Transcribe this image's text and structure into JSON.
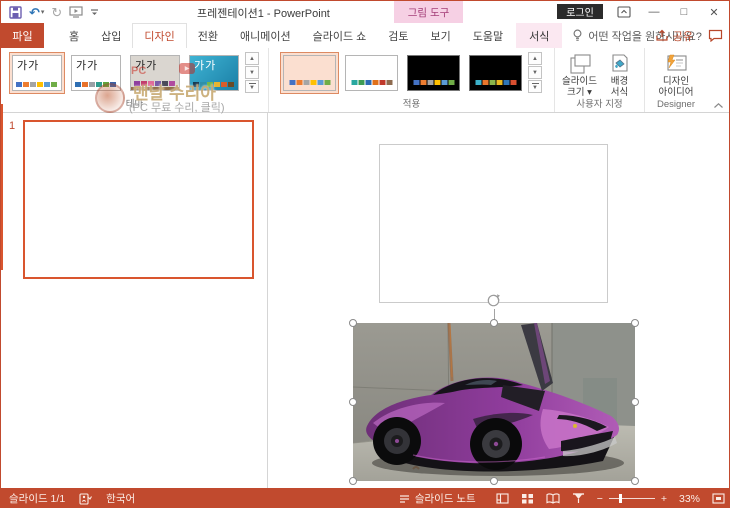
{
  "colors": {
    "accent": "#C14A2E",
    "contextual_tab_bg": "#F6D0E4",
    "contextual_tab_text": "#A43E78",
    "gallery_selection": "#DD8A62",
    "statusbar_bg": "#C14A2E"
  },
  "titlebar": {
    "title": "프레젠테이션1 - PowerPoint",
    "contextual_group": "그림 도구",
    "login_button": "로그인",
    "min": "—",
    "max": "□",
    "close": "✕",
    "undo_glyph": "↶",
    "redo_glyph": "↻",
    "qat_caret": "▾"
  },
  "tabs": {
    "file": "파일",
    "items": [
      "홈",
      "삽입",
      "디자인",
      "전환",
      "애니메이션",
      "슬라이드 쇼",
      "검토",
      "보기",
      "도움말"
    ],
    "active": "디자인",
    "contextual": "서식",
    "search_placeholder": "어떤 작업을 원하시나요?",
    "share": "공유"
  },
  "ribbon": {
    "themes": {
      "group_label": "테마",
      "sample_text": "가가",
      "items": [
        {
          "swatches": [
            "#4472C4",
            "#ED7D31",
            "#A5A5A5",
            "#FFC000",
            "#5B9BD5",
            "#70AD47"
          ]
        },
        {
          "swatches": [
            "#2F6FB3",
            "#E8722A",
            "#9AA0A6",
            "#2E9C8E",
            "#5FA63C",
            "#3A62A8"
          ]
        },
        {
          "swatches": [
            "#8E3E9E",
            "#C23A6A",
            "#E06A9A",
            "#7A5AA8",
            "#4A4A5A",
            "#B04AA0"
          ]
        },
        {
          "swatches": [
            "#16394F",
            "#2E8FA8",
            "#74B64A",
            "#E8B430",
            "#D85C2B",
            "#6B4A26"
          ]
        }
      ]
    },
    "variants": {
      "group_label": "적용",
      "items": [
        {
          "swatches": [
            "#4472C4",
            "#ED7D31",
            "#A5A5A5",
            "#FFC000",
            "#5B9BD5",
            "#70AD47"
          ]
        },
        {
          "swatches": [
            "#2AA8A0",
            "#3E9C54",
            "#2B6BB3",
            "#E0701A",
            "#C0392B",
            "#8E6B4F"
          ]
        },
        {
          "swatches": [
            "#4472C4",
            "#ED7D31",
            "#A5A5A5",
            "#FFC000",
            "#5B9BD5",
            "#70AD47"
          ]
        },
        {
          "swatches": [
            "#3BB0C9",
            "#E8762C",
            "#8AB54A",
            "#E8B820",
            "#2E75B6",
            "#D94F30"
          ]
        }
      ]
    },
    "customize": {
      "group_label": "사용자 지정",
      "slide_size": "슬라이드\n크기 ▾",
      "format_background": "배경\n서식"
    },
    "designer": {
      "group_label": "Designer",
      "design_ideas": "디자인\n아이디어"
    }
  },
  "watermark": {
    "pc": "PC",
    "play": "▶",
    "line1": "맨날 수리아",
    "line2": "(PC 무료 수리, 클릭)"
  },
  "slide_panel": {
    "number": "1"
  },
  "canvas": {
    "picture_alt": "보라색 컨셉 스포츠카 사진"
  },
  "statusbar": {
    "slide_counter": "슬라이드 1/1",
    "language": "한국어",
    "notes": "슬라이드 노트",
    "zoom_out": "−",
    "zoom_in": "+",
    "zoom_level": "33%"
  }
}
